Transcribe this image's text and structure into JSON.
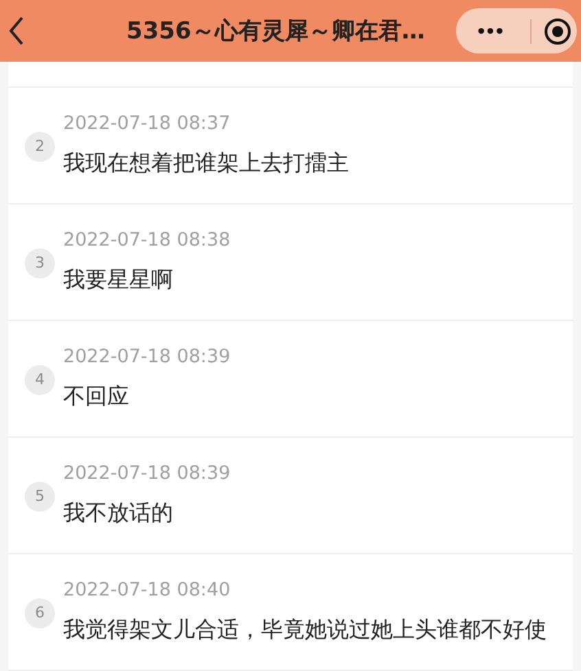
{
  "header": {
    "title": "5356～心有灵犀～卿在君…",
    "more_button": "•••"
  },
  "messages": [
    {
      "index": "2",
      "time": "2022-07-18 08:37",
      "text": "我现在想着把谁架上去打擂主"
    },
    {
      "index": "3",
      "time": "2022-07-18 08:38",
      "text": "我要星星啊"
    },
    {
      "index": "4",
      "time": "2022-07-18 08:39",
      "text": "不回应"
    },
    {
      "index": "5",
      "time": "2022-07-18 08:39",
      "text": "我不放话的"
    },
    {
      "index": "6",
      "time": "2022-07-18 08:40",
      "text": "我觉得架文儿合适，毕竟她说过她上头谁都不好使"
    }
  ]
}
